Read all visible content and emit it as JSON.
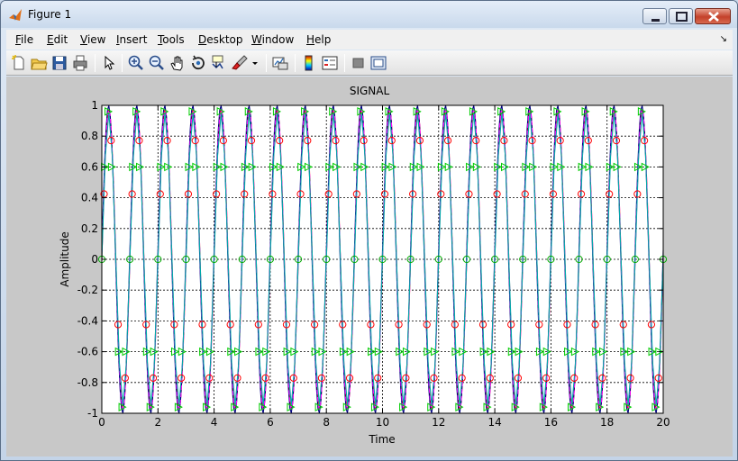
{
  "window": {
    "title": "Figure 1"
  },
  "menu": [
    "File",
    "Edit",
    "View",
    "Insert",
    "Tools",
    "Desktop",
    "Window",
    "Help"
  ],
  "toolbar": [
    "new-figure",
    "open-file",
    "save",
    "print",
    "edit-plot",
    "zoom-in",
    "zoom-out",
    "pan",
    "rotate-3d",
    "data-cursor",
    "brush",
    "link-plot",
    "insert-colorbar",
    "insert-legend",
    "hide-plot-tools",
    "show-plot-tools"
  ],
  "chart_data": {
    "type": "line",
    "title": "SIGNAL",
    "xlabel": "Time",
    "ylabel": "Amplitude",
    "xlim": [
      0,
      20
    ],
    "ylim": [
      -1,
      1
    ],
    "xticks": [
      0,
      2,
      4,
      6,
      8,
      10,
      12,
      14,
      16,
      18,
      20
    ],
    "yticks": [
      -1,
      -0.8,
      -0.6,
      -0.4,
      -0.2,
      0,
      0.2,
      0.4,
      0.6,
      0.8,
      1
    ],
    "grid": true,
    "signal": {
      "frequency": 1,
      "sample_step": 0.25
    },
    "series": [
      {
        "color": "#ff0000",
        "style": "solid",
        "marker": "none",
        "shape": "sine"
      },
      {
        "color": "#000080",
        "style": "solid",
        "marker": "none",
        "shape": "sine-dense"
      },
      {
        "color": "#ff00ff",
        "style": "dashed",
        "marker": "none",
        "shape": "sine"
      },
      {
        "color": "#00aaaa",
        "style": "solid",
        "marker": "none",
        "shape": "sampled"
      },
      {
        "color": "#ff0000",
        "style": "none",
        "marker": "circle",
        "shape": "sampled-a"
      },
      {
        "color": "#00cc00",
        "style": "none",
        "marker": "triangle-right",
        "shape": "sampled-b"
      },
      {
        "color": "#00aa00",
        "style": "none",
        "marker": "circle",
        "shape": "zeros"
      }
    ]
  }
}
